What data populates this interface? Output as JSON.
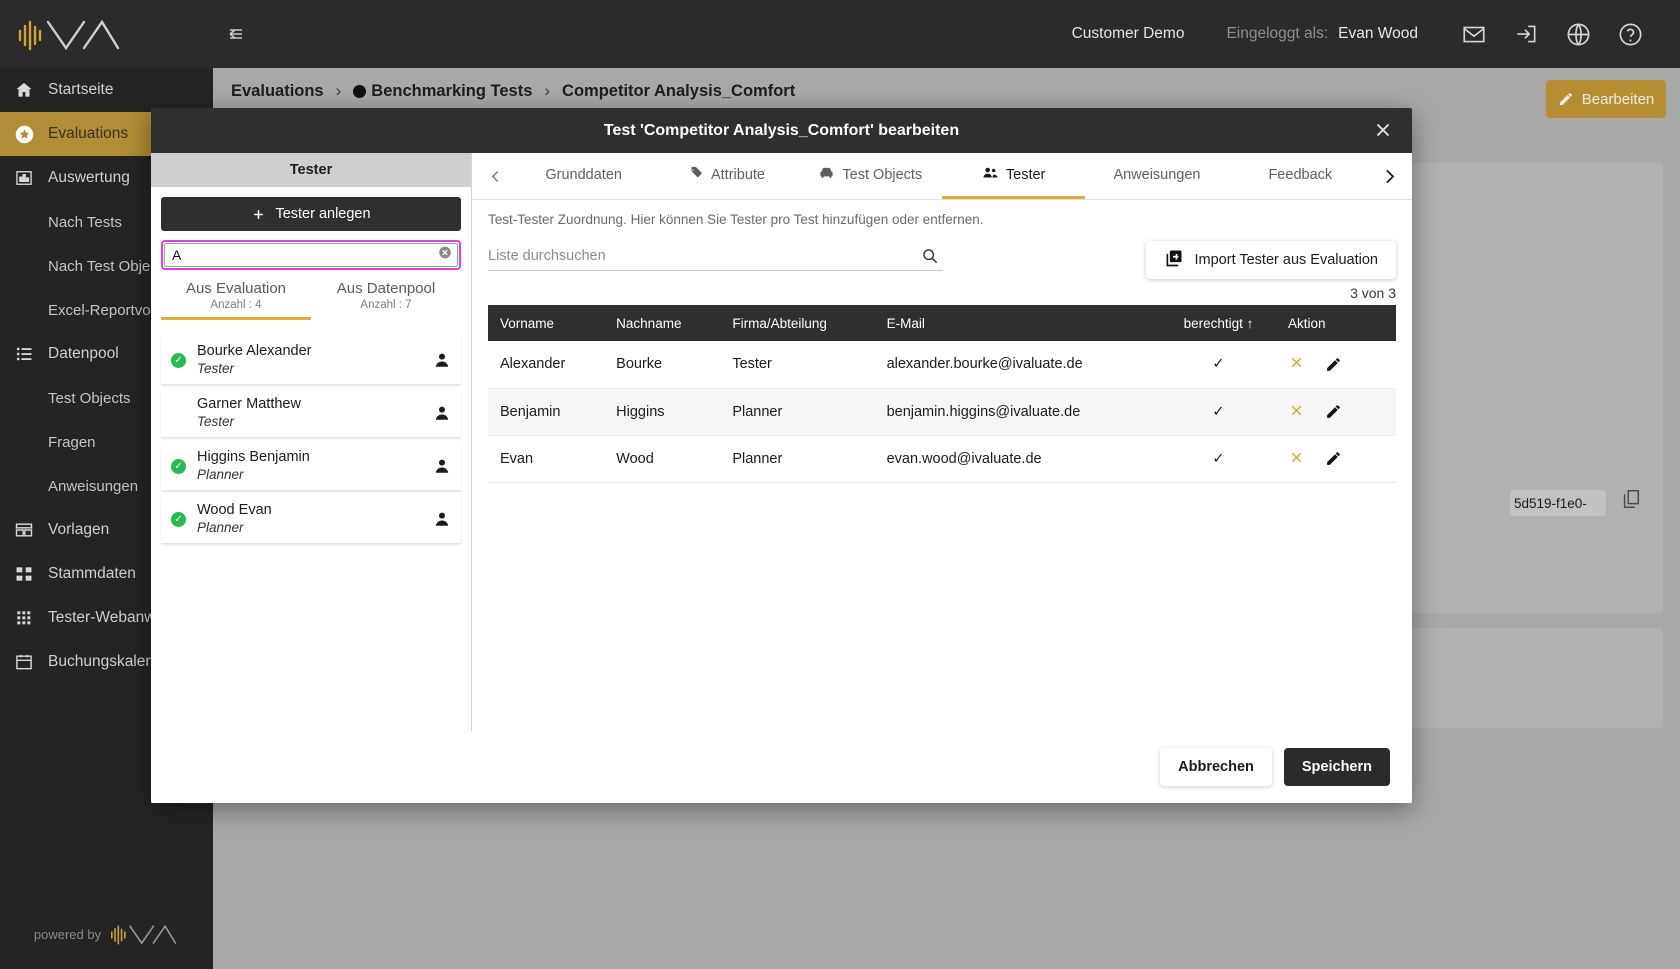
{
  "topbar": {
    "customer": "Customer Demo",
    "logged_label": "Eingeloggt als:",
    "logged_user": "Evan Wood",
    "icons": [
      "mail-icon",
      "logout-icon",
      "globe-icon",
      "help-icon"
    ]
  },
  "sidebar": {
    "items": [
      {
        "label": "Startseite",
        "icon": "home-icon",
        "active": false,
        "sub": false
      },
      {
        "label": "Evaluations",
        "icon": "star-icon",
        "active": true,
        "sub": false
      },
      {
        "label": "Auswertung",
        "icon": "chart-icon",
        "active": false,
        "sub": false
      },
      {
        "label": "Nach Tests",
        "icon": "",
        "active": false,
        "sub": true
      },
      {
        "label": "Nach Test Objects",
        "icon": "",
        "active": false,
        "sub": true
      },
      {
        "label": "Excel-Reportvorlagen",
        "icon": "",
        "active": false,
        "sub": true
      },
      {
        "label": "Datenpool",
        "icon": "list-icon",
        "active": false,
        "sub": false
      },
      {
        "label": "Test Objects",
        "icon": "",
        "active": false,
        "sub": true
      },
      {
        "label": "Fragen",
        "icon": "",
        "active": false,
        "sub": true
      },
      {
        "label": "Anweisungen",
        "icon": "",
        "active": false,
        "sub": true
      },
      {
        "label": "Vorlagen",
        "icon": "template-icon",
        "active": false,
        "sub": false
      },
      {
        "label": "Stammdaten",
        "icon": "hierarchy-icon",
        "active": false,
        "sub": false
      },
      {
        "label": "Tester-Webanwendung",
        "icon": "grid-icon",
        "active": false,
        "sub": false
      },
      {
        "label": "Buchungskalender",
        "icon": "calendar-icon",
        "active": false,
        "sub": false
      }
    ],
    "powered_by": "powered by"
  },
  "page": {
    "breadcrumb": [
      "Evaluations",
      "Benchmarking Tests",
      "Competitor Analysis_Comfort"
    ],
    "edit_button": "Bearbeiten",
    "background_id": "5d519-f1e0-"
  },
  "modal": {
    "title": "Test 'Competitor Analysis_Comfort' bearbeiten",
    "close_icon": "close-icon",
    "left": {
      "panel_title": "Tester",
      "create_button": "Tester anlegen",
      "search_value": "A",
      "tabs": [
        {
          "label": "Aus Evaluation",
          "count": "Anzahl : 4",
          "active": true
        },
        {
          "label": "Aus Datenpool",
          "count": "Anzahl : 7",
          "active": false
        }
      ],
      "list": [
        {
          "name": "Bourke Alexander",
          "role": "Tester",
          "selected": true
        },
        {
          "name": "Garner Matthew",
          "role": "Tester",
          "selected": false
        },
        {
          "name": "Higgins Benjamin",
          "role": "Planner",
          "selected": true
        },
        {
          "name": "Wood Evan",
          "role": "Planner",
          "selected": true
        }
      ]
    },
    "tabs": [
      {
        "label": "Grunddaten",
        "icon": "",
        "active": false
      },
      {
        "label": "Attribute",
        "icon": "tag-icon",
        "active": false
      },
      {
        "label": "Test Objects",
        "icon": "car-icon",
        "active": false
      },
      {
        "label": "Tester",
        "icon": "people-icon",
        "active": true
      },
      {
        "label": "Anweisungen",
        "icon": "",
        "active": false
      },
      {
        "label": "Feedback",
        "icon": "",
        "active": false
      }
    ],
    "description": "Test-Tester Zuordnung. Hier können Sie Tester pro Test hinzufügen oder entfernen.",
    "list_search_placeholder": "Liste durchsuchen",
    "list_search_value": "",
    "import_button": "Import Tester aus Evaluation",
    "count_text": "3 von 3",
    "table": {
      "headers": [
        "Vorname",
        "Nachname",
        "Firma/Abteilung",
        "E-Mail",
        "berechtigt ↑",
        "Aktion"
      ],
      "rows": [
        {
          "vorname": "Alexander",
          "nachname": "Bourke",
          "firma": "Tester",
          "email": "alexander.bourke@ivaluate.de",
          "berechtigt": "✓"
        },
        {
          "vorname": "Benjamin",
          "nachname": "Higgins",
          "firma": "Planner",
          "email": "benjamin.higgins@ivaluate.de",
          "berechtigt": "✓"
        },
        {
          "vorname": "Evan",
          "nachname": "Wood",
          "firma": "Planner",
          "email": "evan.wood@ivaluate.de",
          "berechtigt": "✓"
        }
      ]
    },
    "footer": {
      "cancel": "Abbrechen",
      "save": "Speichern"
    }
  },
  "colors": {
    "accent_gold": "#b78d33",
    "tab_underline": "#e0ab3e",
    "action_x": "#e8a33a",
    "check_green": "#2aba52",
    "highlight_ring": "#e83ae8",
    "input_border": "#77c277"
  }
}
